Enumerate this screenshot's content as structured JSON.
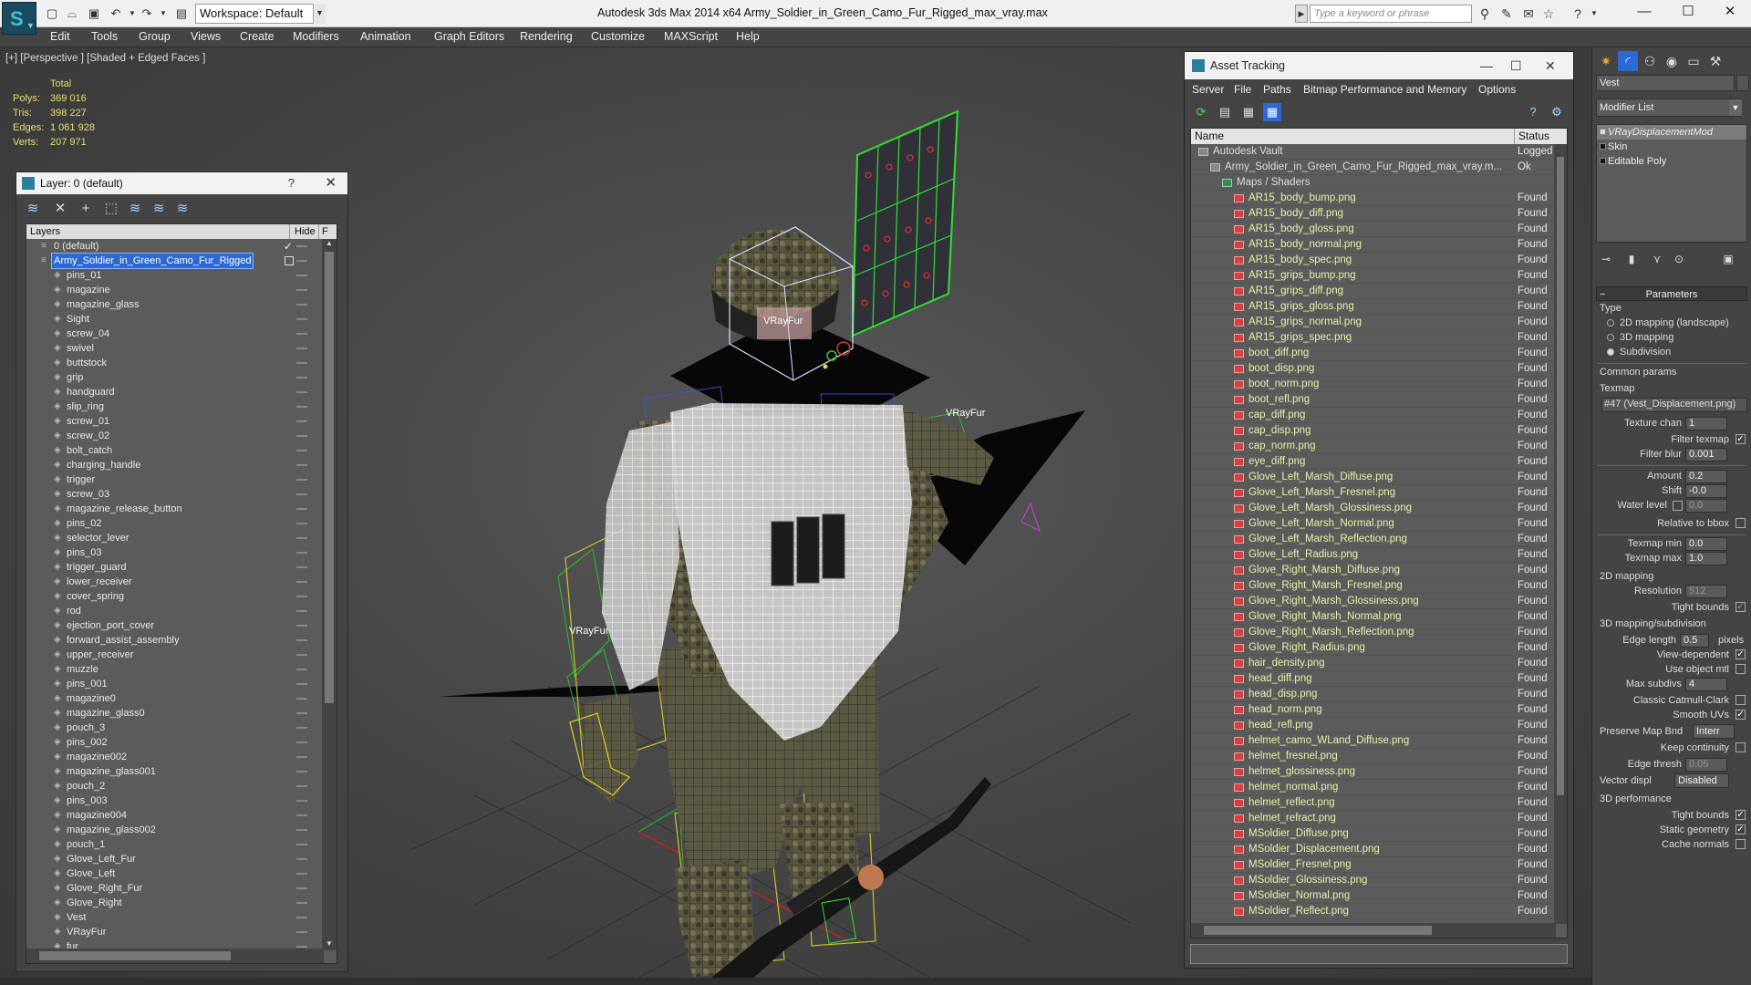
{
  "window": {
    "title": "Autodesk 3ds Max  2014 x64      Army_Soldier_in_Green_Camo_Fur_Rigged_max_vray.max",
    "workspace": "Workspace: Default",
    "search_placeholder": "Type a keyword or phrase"
  },
  "menu": [
    "Edit",
    "Tools",
    "Group",
    "Views",
    "Create",
    "Modifiers",
    "Animation",
    "Graph Editors",
    "Rendering",
    "Customize",
    "MAXScript",
    "Help"
  ],
  "viewport": {
    "label": "[+] [Perspective ] [Shaded + Edged Faces ]",
    "stats_header": "Total",
    "stats": [
      {
        "label": "Polys:",
        "value": "369 016"
      },
      {
        "label": "Tris:",
        "value": "398 227"
      },
      {
        "label": "Edges:",
        "value": "1 061 928"
      },
      {
        "label": "Verts:",
        "value": "207 971"
      }
    ],
    "fur_labels": [
      "VRayFur",
      "VRayFur",
      "VRayFur"
    ]
  },
  "layer_panel": {
    "title": "Layer: 0 (default)",
    "help": "?",
    "close": "✕",
    "col_layers": "Layers",
    "col_hide": "Hide",
    "col_f": "F",
    "rows": [
      {
        "name": "0 (default)",
        "level": 0,
        "active": true
      },
      {
        "name": "Army_Soldier_in_Green_Camo_Fur_Rigged",
        "level": 0,
        "selected": true
      },
      {
        "name": "pins_01",
        "level": 1
      },
      {
        "name": "magazine",
        "level": 1
      },
      {
        "name": "magazine_glass",
        "level": 1
      },
      {
        "name": "Sight",
        "level": 1
      },
      {
        "name": "screw_04",
        "level": 1
      },
      {
        "name": "swivel",
        "level": 1
      },
      {
        "name": "buttstock",
        "level": 1
      },
      {
        "name": "grip",
        "level": 1
      },
      {
        "name": "handguard",
        "level": 1
      },
      {
        "name": "slip_ring",
        "level": 1
      },
      {
        "name": "screw_01",
        "level": 1
      },
      {
        "name": "screw_02",
        "level": 1
      },
      {
        "name": "bolt_catch",
        "level": 1
      },
      {
        "name": "charging_handle",
        "level": 1
      },
      {
        "name": "trigger",
        "level": 1
      },
      {
        "name": "screw_03",
        "level": 1
      },
      {
        "name": "magazine_release_button",
        "level": 1
      },
      {
        "name": "pins_02",
        "level": 1
      },
      {
        "name": "selector_lever",
        "level": 1
      },
      {
        "name": "pins_03",
        "level": 1
      },
      {
        "name": "trigger_guard",
        "level": 1
      },
      {
        "name": "lower_receiver",
        "level": 1
      },
      {
        "name": "cover_spring",
        "level": 1
      },
      {
        "name": "rod",
        "level": 1
      },
      {
        "name": "ejection_port_cover",
        "level": 1
      },
      {
        "name": "forward_assist_assembly",
        "level": 1
      },
      {
        "name": "upper_receiver",
        "level": 1
      },
      {
        "name": "muzzle",
        "level": 1
      },
      {
        "name": "pins_001",
        "level": 1
      },
      {
        "name": "magazine0",
        "level": 1
      },
      {
        "name": "magazine_glass0",
        "level": 1
      },
      {
        "name": "pouch_3",
        "level": 1
      },
      {
        "name": "pins_002",
        "level": 1
      },
      {
        "name": "magazine002",
        "level": 1
      },
      {
        "name": "magazine_glass001",
        "level": 1
      },
      {
        "name": "pouch_2",
        "level": 1
      },
      {
        "name": "pins_003",
        "level": 1
      },
      {
        "name": "magazine004",
        "level": 1
      },
      {
        "name": "magazine_glass002",
        "level": 1
      },
      {
        "name": "pouch_1",
        "level": 1
      },
      {
        "name": "Glove_Left_Fur",
        "level": 1
      },
      {
        "name": "Glove_Left",
        "level": 1
      },
      {
        "name": "Glove_Right_Fur",
        "level": 1
      },
      {
        "name": "Glove_Right",
        "level": 1
      },
      {
        "name": "Vest",
        "level": 1
      },
      {
        "name": "VRayFur",
        "level": 1
      },
      {
        "name": "fur",
        "level": 1
      }
    ]
  },
  "asset_panel": {
    "title": "Asset Tracking",
    "menu": [
      "Server",
      "File",
      "Paths",
      "Bitmap Performance and Memory",
      "Options"
    ],
    "col_name": "Name",
    "col_status": "Status",
    "rows": [
      {
        "name": "Autodesk Vault",
        "status": "Logged",
        "indent": 1,
        "icon": "vault"
      },
      {
        "name": "Army_Soldier_in_Green_Camo_Fur_Rigged_max_vray.m...",
        "status": "Ok",
        "indent": 2,
        "icon": "file"
      },
      {
        "name": "Maps / Shaders",
        "status": "",
        "indent": 3,
        "icon": "maps"
      },
      {
        "name": "AR15_body_bump.png",
        "status": "Found",
        "indent": 4
      },
      {
        "name": "AR15_body_diff.png",
        "status": "Found",
        "indent": 4
      },
      {
        "name": "AR15_body_gloss.png",
        "status": "Found",
        "indent": 4
      },
      {
        "name": "AR15_body_normal.png",
        "status": "Found",
        "indent": 4
      },
      {
        "name": "AR15_body_spec.png",
        "status": "Found",
        "indent": 4
      },
      {
        "name": "AR15_grips_bump.png",
        "status": "Found",
        "indent": 4
      },
      {
        "name": "AR15_grips_diff.png",
        "status": "Found",
        "indent": 4
      },
      {
        "name": "AR15_grips_gloss.png",
        "status": "Found",
        "indent": 4
      },
      {
        "name": "AR15_grips_normal.png",
        "status": "Found",
        "indent": 4
      },
      {
        "name": "AR15_grips_spec.png",
        "status": "Found",
        "indent": 4
      },
      {
        "name": "boot_diff.png",
        "status": "Found",
        "indent": 4
      },
      {
        "name": "boot_disp.png",
        "status": "Found",
        "indent": 4
      },
      {
        "name": "boot_norm.png",
        "status": "Found",
        "indent": 4
      },
      {
        "name": "boot_refl.png",
        "status": "Found",
        "indent": 4
      },
      {
        "name": "cap_diff.png",
        "status": "Found",
        "indent": 4
      },
      {
        "name": "cap_disp.png",
        "status": "Found",
        "indent": 4
      },
      {
        "name": "cap_norm.png",
        "status": "Found",
        "indent": 4
      },
      {
        "name": "eye_diff.png",
        "status": "Found",
        "indent": 4
      },
      {
        "name": "Glove_Left_Marsh_Diffuse.png",
        "status": "Found",
        "indent": 4
      },
      {
        "name": "Glove_Left_Marsh_Fresnel.png",
        "status": "Found",
        "indent": 4
      },
      {
        "name": "Glove_Left_Marsh_Glossiness.png",
        "status": "Found",
        "indent": 4
      },
      {
        "name": "Glove_Left_Marsh_Normal.png",
        "status": "Found",
        "indent": 4
      },
      {
        "name": "Glove_Left_Marsh_Reflection.png",
        "status": "Found",
        "indent": 4
      },
      {
        "name": "Glove_Left_Radius.png",
        "status": "Found",
        "indent": 4
      },
      {
        "name": "Glove_Right_Marsh_Diffuse.png",
        "status": "Found",
        "indent": 4
      },
      {
        "name": "Glove_Right_Marsh_Fresnel.png",
        "status": "Found",
        "indent": 4
      },
      {
        "name": "Glove_Right_Marsh_Glossiness.png",
        "status": "Found",
        "indent": 4
      },
      {
        "name": "Glove_Right_Marsh_Normal.png",
        "status": "Found",
        "indent": 4
      },
      {
        "name": "Glove_Right_Marsh_Reflection.png",
        "status": "Found",
        "indent": 4
      },
      {
        "name": "Glove_Right_Radius.png",
        "status": "Found",
        "indent": 4
      },
      {
        "name": "hair_density.png",
        "status": "Found",
        "indent": 4
      },
      {
        "name": "head_diff.png",
        "status": "Found",
        "indent": 4
      },
      {
        "name": "head_disp.png",
        "status": "Found",
        "indent": 4
      },
      {
        "name": "head_norm.png",
        "status": "Found",
        "indent": 4
      },
      {
        "name": "head_refl.png",
        "status": "Found",
        "indent": 4
      },
      {
        "name": "helmet_camo_WLand_Diffuse.png",
        "status": "Found",
        "indent": 4
      },
      {
        "name": "helmet_fresnel.png",
        "status": "Found",
        "indent": 4
      },
      {
        "name": "helmet_glossiness.png",
        "status": "Found",
        "indent": 4
      },
      {
        "name": "helmet_normal.png",
        "status": "Found",
        "indent": 4
      },
      {
        "name": "helmet_reflect.png",
        "status": "Found",
        "indent": 4
      },
      {
        "name": "helmet_refract.png",
        "status": "Found",
        "indent": 4
      },
      {
        "name": "MSoldier_Diffuse.png",
        "status": "Found",
        "indent": 4
      },
      {
        "name": "MSoldier_Displacement.png",
        "status": "Found",
        "indent": 4
      },
      {
        "name": "MSoldier_Fresnel.png",
        "status": "Found",
        "indent": 4
      },
      {
        "name": "MSoldier_Glossiness.png",
        "status": "Found",
        "indent": 4
      },
      {
        "name": "MSoldier_Normal.png",
        "status": "Found",
        "indent": 4
      },
      {
        "name": "MSoldier_Reflect.png",
        "status": "Found",
        "indent": 4
      }
    ]
  },
  "command_panel": {
    "object_name": "Vest",
    "modifier_list": "Modifier List",
    "stack": [
      {
        "name": "VRayDisplacementMod",
        "selected": true
      },
      {
        "name": "Skin"
      },
      {
        "name": "Editable Poly"
      }
    ],
    "parameters_title": "Parameters",
    "type_label": "Type",
    "type_options": [
      {
        "label": "2D mapping (landscape)",
        "on": false
      },
      {
        "label": "3D mapping",
        "on": false
      },
      {
        "label": "Subdivision",
        "on": true
      }
    ],
    "common_params": "Common params",
    "texmap_label": "Texmap",
    "texmap_value": "#47 (Vest_Displacement.png)",
    "texture_chan_label": "Texture chan",
    "texture_chan": "1",
    "filter_texmap_label": "Filter texmap",
    "filter_blur_label": "Filter blur",
    "filter_blur": "0.001",
    "amount_label": "Amount",
    "amount": "0.2",
    "shift_label": "Shift",
    "shift": "-0.0",
    "water_level_label": "Water level",
    "water_level": "0.0",
    "relative_bbox_label": "Relative to bbox",
    "texmap_min_label": "Texmap min",
    "texmap_min": "0.0",
    "texmap_max_label": "Texmap max",
    "texmap_max": "1.0",
    "mapping2d": "2D mapping",
    "resolution_label": "Resolution",
    "resolution": "512",
    "tight_bounds_label": "Tight bounds",
    "mapping3d": "3D mapping/subdivision",
    "edge_length_label": "Edge length",
    "edge_length": "0.5",
    "pixels_label": "pixels",
    "view_dependent_label": "View-dependent",
    "use_object_mtl_label": "Use object mtl",
    "max_subdivs_label": "Max subdivs",
    "max_subdivs": "4",
    "classic_cc_label": "Classic Catmull-Clark",
    "smooth_uvs_label": "Smooth UVs",
    "preserve_map_label": "Preserve Map Bnd",
    "preserve_map_value": "Interr",
    "keep_continuity_label": "Keep continuity",
    "edge_thresh_label": "Edge thresh",
    "edge_thresh": "0.05",
    "vector_displ_label": "Vector displ",
    "vector_displ_value": "Disabled",
    "perf_title": "3D performance",
    "perf_tight_bounds": "Tight bounds",
    "static_geometry_label": "Static geometry",
    "cache_normals_label": "Cache normals"
  }
}
